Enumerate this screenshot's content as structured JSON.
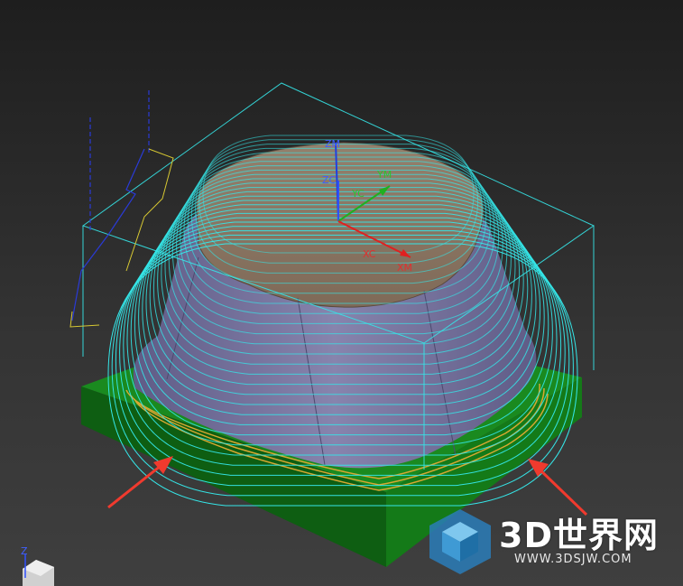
{
  "work_axes": {
    "zm": "ZM",
    "zc": "ZC",
    "ym": "YM",
    "yc": "YC",
    "xc": "XC",
    "xm": "XM"
  },
  "triad": {
    "z": "Z"
  },
  "watermark": {
    "brand": "3D世界网",
    "url": "WWW.3DSJW.COM"
  },
  "colors": {
    "base_block": "#0f6b12",
    "part_top": "#8a7562",
    "part_sides": "#77739c",
    "toolpath": "#35e6e8",
    "toolpath_finish": "#d7a832",
    "arrow": "#f03a2e",
    "axis_x": "#e02020",
    "axis_y": "#20b020",
    "axis_z": "#2040e0"
  },
  "icons": [
    "red-arrow-icon",
    "coordinate-triad-icon",
    "watermark-cube-icon"
  ]
}
